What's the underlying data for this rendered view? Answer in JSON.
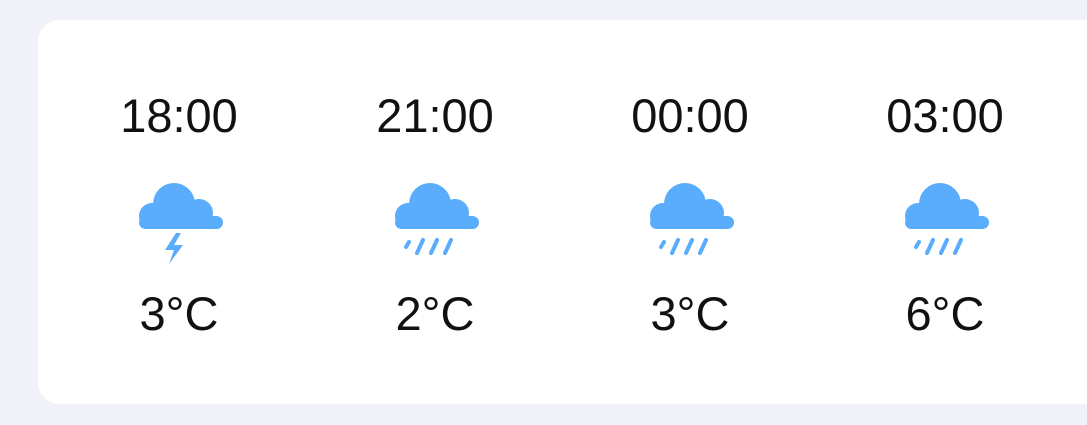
{
  "forecast": {
    "colors": {
      "icon": "#5aacfc",
      "background": "#f1f2f9",
      "card": "#ffffff",
      "text": "#111111"
    },
    "hours": [
      {
        "time": "18:00",
        "condition": "thunderstorm-icon",
        "temp": "3°C"
      },
      {
        "time": "21:00",
        "condition": "rain-icon",
        "temp": "2°C"
      },
      {
        "time": "00:00",
        "condition": "rain-icon",
        "temp": "3°C"
      },
      {
        "time": "03:00",
        "condition": "rain-icon",
        "temp": "6°C"
      }
    ]
  }
}
